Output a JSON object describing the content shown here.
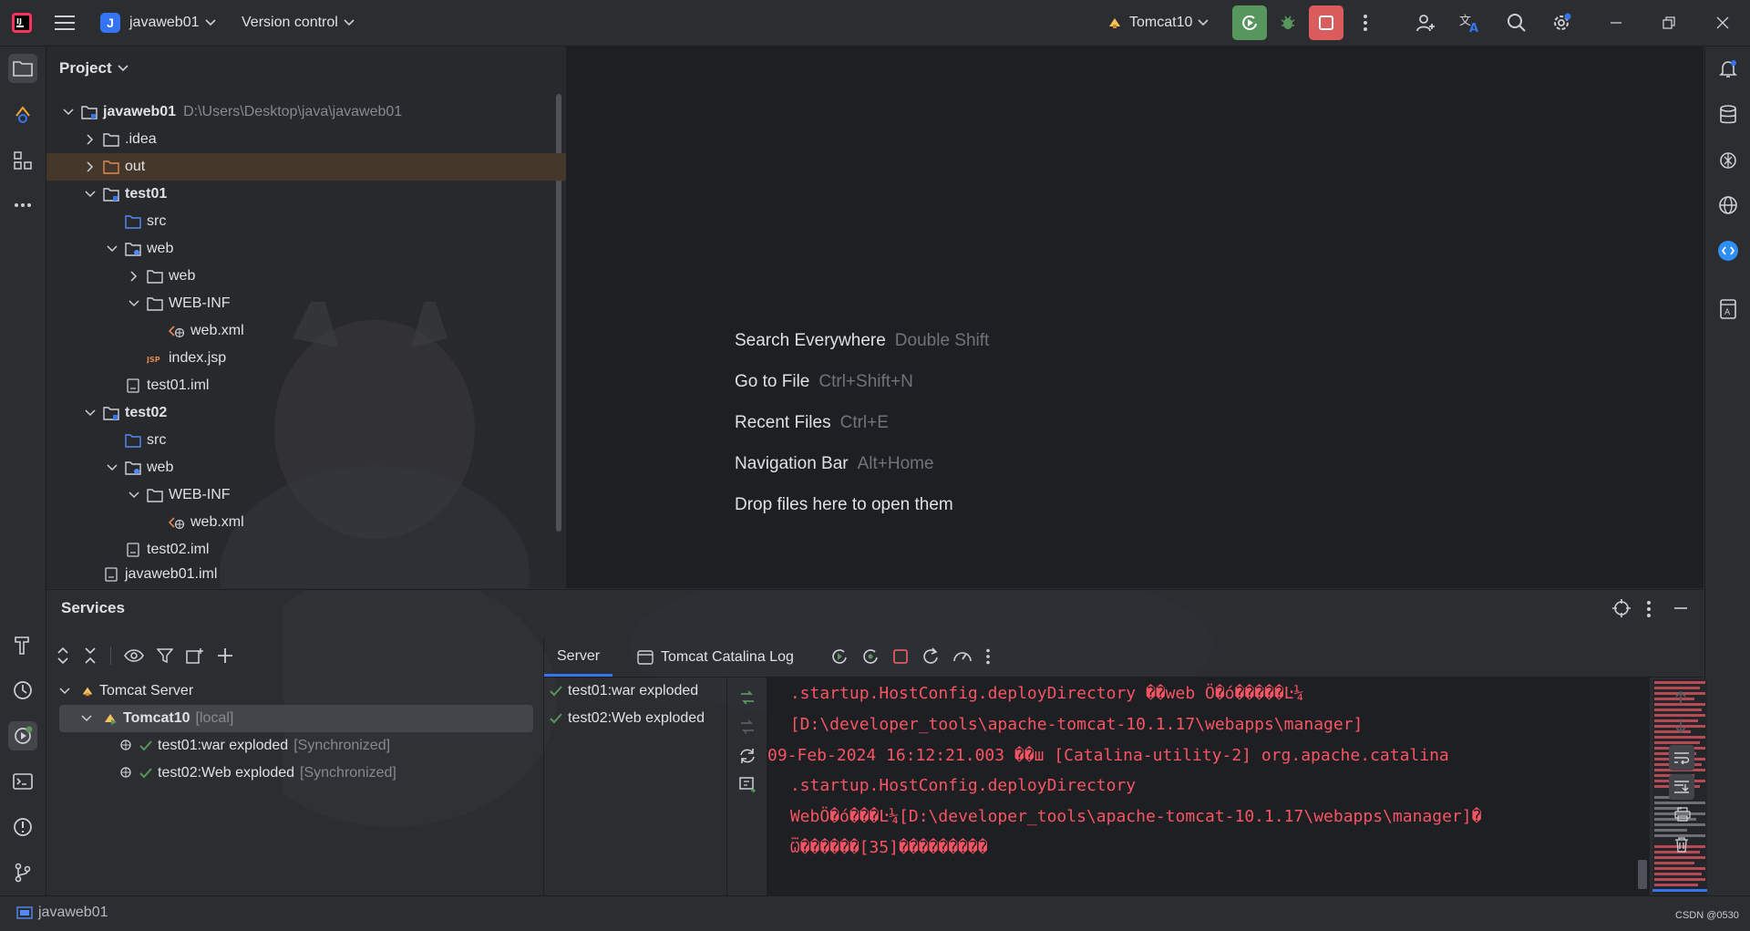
{
  "titlebar": {
    "project_initial": "J",
    "project_name": "javaweb01",
    "vcs_label": "Version control",
    "run_config": "Tomcat10"
  },
  "project_panel": {
    "title": "Project",
    "tree": [
      {
        "label": "javaweb01",
        "path": "D:\\Users\\Desktop\\java\\javaweb01"
      },
      {
        "label": ".idea"
      },
      {
        "label": "out"
      },
      {
        "label": "test01"
      },
      {
        "label": "src"
      },
      {
        "label": "web"
      },
      {
        "label": "web"
      },
      {
        "label": "WEB-INF"
      },
      {
        "label": "web.xml"
      },
      {
        "label": "index.jsp"
      },
      {
        "label": "test01.iml"
      },
      {
        "label": "test02"
      },
      {
        "label": "src"
      },
      {
        "label": "web"
      },
      {
        "label": "WEB-INF"
      },
      {
        "label": "web.xml"
      },
      {
        "label": "test02.iml"
      },
      {
        "label": "javaweb01.iml"
      }
    ]
  },
  "editor": {
    "hints": [
      {
        "label": "Search Everywhere",
        "key": "Double Shift"
      },
      {
        "label": "Go to File",
        "key": "Ctrl+Shift+N"
      },
      {
        "label": "Recent Files",
        "key": "Ctrl+E"
      },
      {
        "label": "Navigation Bar",
        "key": "Alt+Home"
      },
      {
        "label": "Drop files here to open them",
        "key": ""
      }
    ]
  },
  "services": {
    "title": "Services",
    "tree": [
      {
        "label": "Tomcat Server"
      },
      {
        "label": "Tomcat10",
        "suffix": "[local]"
      },
      {
        "label": "test01:war exploded",
        "suffix": "[Synchronized]"
      },
      {
        "label": "test02:Web exploded",
        "suffix": "[Synchronized]"
      }
    ],
    "tabs": [
      "Server",
      "Tomcat Catalina Log"
    ],
    "deployments": [
      "test01:war exploded",
      "test02:Web exploded"
    ],
    "log_lines": [
      " .startup.HostConfig.deployDirectory ��web Ö�ó�����Ŀ¼",
      " [D:\\developer_tools\\apache-tomcat-10.1.17\\webapps\\manager]",
      "09-Feb-2024 16:12:21.003 ��ш [Catalina-utility-2] org.apache.catalina",
      " .startup.HostConfig.deployDirectory",
      " WebÖ�ó���Ŀ¼[D:\\developer_tools\\apache-tomcat-10.1.17\\webapps\\manager]�",
      " Ѿ������[35]���������"
    ]
  },
  "statusbar": {
    "project": "javaweb01",
    "watermark": "CSDN @0530"
  },
  "colors": {
    "accent": "#3574f0",
    "run_green": "#57965c",
    "stop_red": "#db5c5c",
    "log_red": "#f75464"
  }
}
